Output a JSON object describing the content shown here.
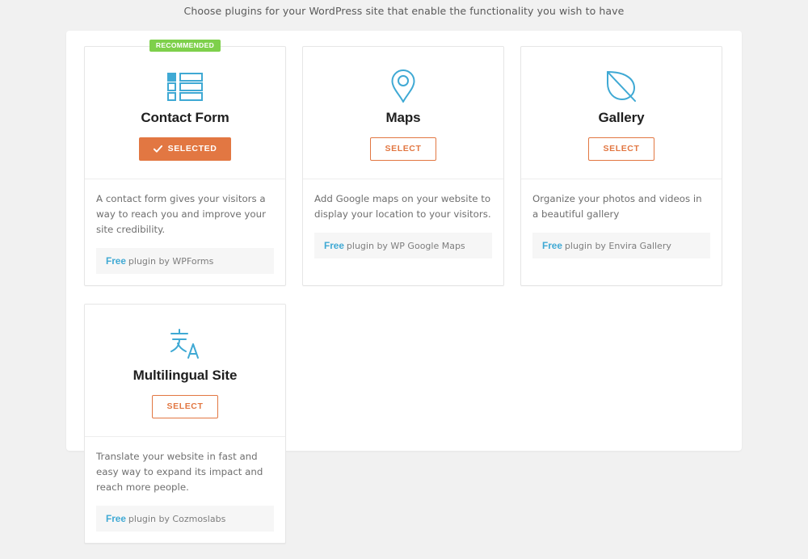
{
  "header": {
    "instruction": "Choose plugins for your WordPress site that enable the functionality you wish to have"
  },
  "theme": {
    "page_background": "#f1f1f1",
    "panel_background": "#ffffff",
    "accent_orange": "#e27742",
    "accent_blue": "#3fa9d4",
    "badge_green": "#7ed04b",
    "meta_background": "#f6f6f6"
  },
  "plugins": [
    {
      "id": "contact-form",
      "badge": "RECOMMENDED",
      "icon": "list-icon",
      "title": "Contact Form",
      "button_label": "SELECTED",
      "button_state": "selected",
      "description": "A contact form gives your visitors a way to reach you and improve your site credibility.",
      "price_label": "Free",
      "author_label": "plugin by WPForms"
    },
    {
      "id": "maps",
      "badge": "",
      "icon": "map-pin-icon",
      "title": "Maps",
      "button_label": "SELECT",
      "button_state": "unselected",
      "description": "Add Google maps on your website to display your location to your visitors.",
      "price_label": "Free",
      "author_label": "plugin by WP Google Maps"
    },
    {
      "id": "gallery",
      "badge": "",
      "icon": "leaf-icon",
      "title": "Gallery",
      "button_label": "SELECT",
      "button_state": "unselected",
      "description": "Organize your photos and videos in a beautiful gallery",
      "price_label": "Free",
      "author_label": "plugin by Envira Gallery"
    },
    {
      "id": "multilingual-site",
      "badge": "",
      "icon": "translate-icon",
      "title": "Multilingual Site",
      "button_label": "SELECT",
      "button_state": "unselected",
      "description": "Translate your website in fast and easy way to expand its impact and reach more people.",
      "price_label": "Free",
      "author_label": "plugin by Cozmoslabs"
    }
  ]
}
